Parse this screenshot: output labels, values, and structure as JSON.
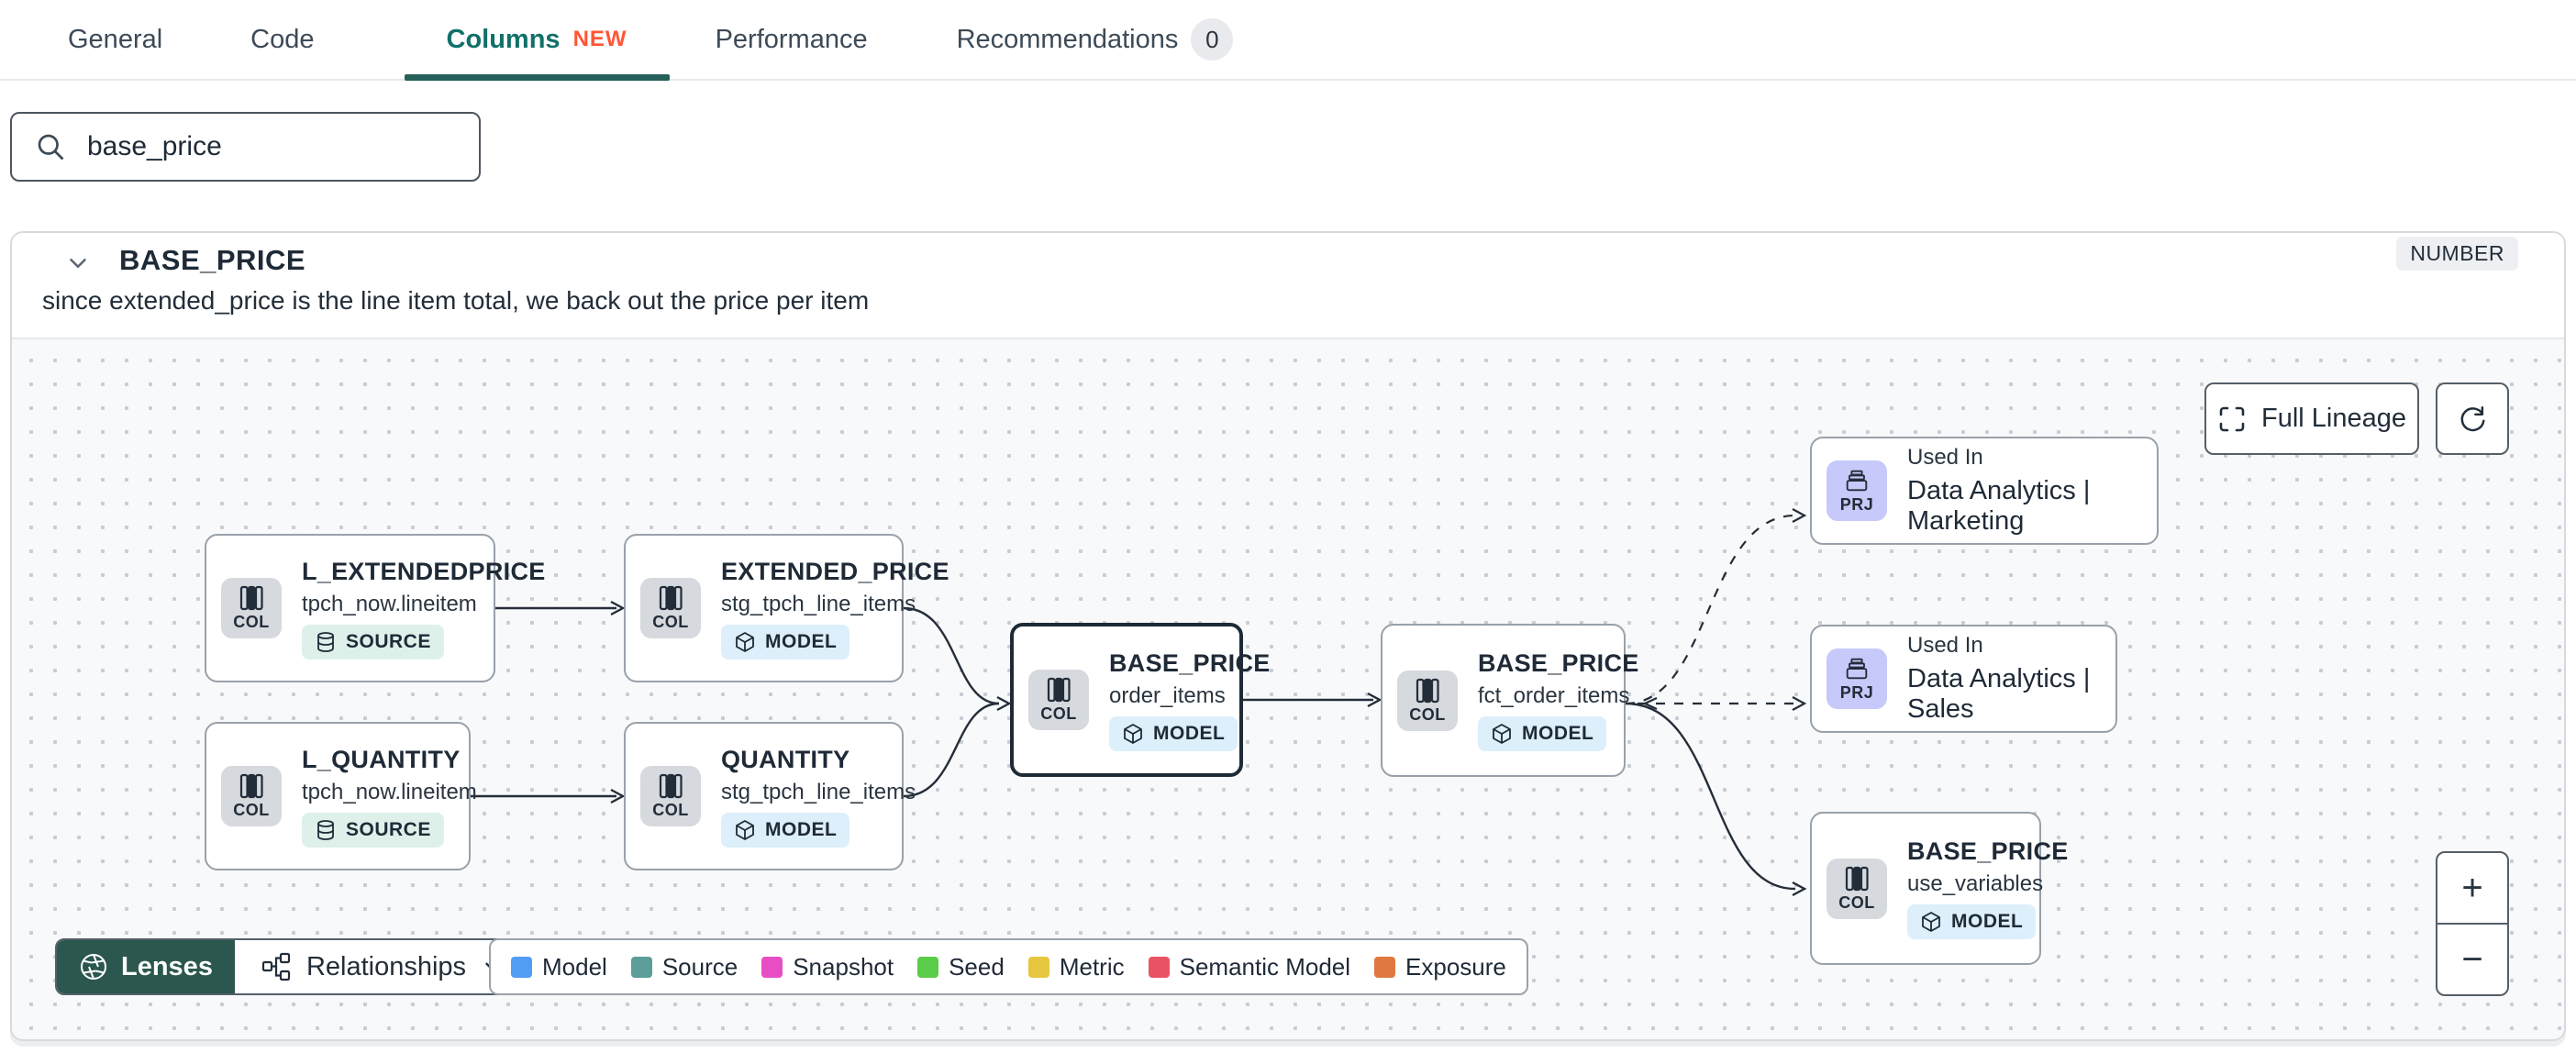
{
  "colors": {
    "accent_teal_underline": "#26605a",
    "active_tab_text": "#11706a",
    "new_badge_orange": "#ff5636",
    "lenses_button_green": "#2b574e"
  },
  "tabs": {
    "general": "General",
    "code": "Code",
    "columns": "Columns",
    "columns_badge": "NEW",
    "performance": "Performance",
    "recommendations": "Recommendations",
    "recommendations_count": "0"
  },
  "search": {
    "value": "base_price"
  },
  "column_panel": {
    "title": "BASE_PRICE",
    "type_badge": "NUMBER",
    "description": "since extended_price is the line item total, we back out the price per item"
  },
  "lineage": {
    "controls": {
      "full_lineage_label": "Full Lineage",
      "zoom_in": "+",
      "zoom_out": "−",
      "lenses_label": "Lenses",
      "relationships_label": "Relationships"
    },
    "nodes": [
      {
        "title": "L_EXTENDEDPRICE",
        "subtitle": "tpch_now.lineitem",
        "chip": "COL",
        "badge": "SOURCE"
      },
      {
        "title": "EXTENDED_PRICE",
        "subtitle": "stg_tpch_line_items",
        "chip": "COL",
        "badge": "MODEL"
      },
      {
        "title": "L_QUANTITY",
        "subtitle": "tpch_now.lineitem",
        "chip": "COL",
        "badge": "SOURCE"
      },
      {
        "title": "QUANTITY",
        "subtitle": "stg_tpch_line_items",
        "chip": "COL",
        "badge": "MODEL"
      },
      {
        "title": "BASE_PRICE",
        "subtitle": "order_items",
        "chip": "COL",
        "badge": "MODEL"
      },
      {
        "title": "BASE_PRICE",
        "subtitle": "fct_order_items",
        "chip": "COL",
        "badge": "MODEL"
      },
      {
        "label": "Used In",
        "title": "Data Analytics | Marketing",
        "chip": "PRJ"
      },
      {
        "label": "Used In",
        "title": "Data Analytics | Sales",
        "chip": "PRJ"
      },
      {
        "title": "BASE_PRICE",
        "subtitle": "use_variables",
        "chip": "COL",
        "badge": "MODEL"
      }
    ],
    "legend": {
      "items": [
        {
          "label": "Model",
          "color": "#519cf4"
        },
        {
          "label": "Source",
          "color": "#5c9d99"
        },
        {
          "label": "Snapshot",
          "color": "#e84ec4"
        },
        {
          "label": "Seed",
          "color": "#5bcc49"
        },
        {
          "label": "Metric",
          "color": "#e7c63f"
        },
        {
          "label": "Semantic Model",
          "color": "#ea5364"
        },
        {
          "label": "Exposure",
          "color": "#e0793f"
        }
      ]
    }
  }
}
